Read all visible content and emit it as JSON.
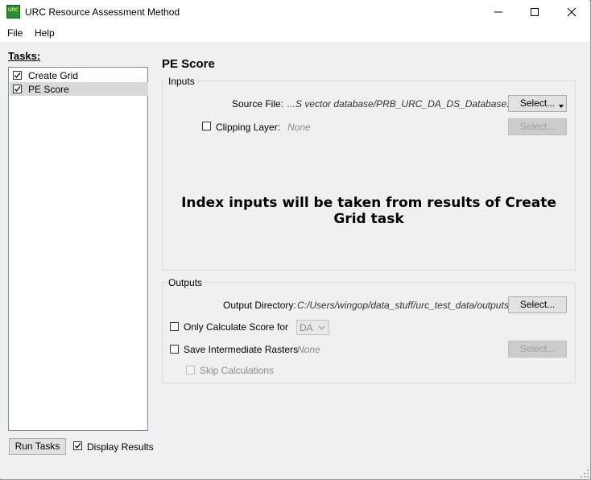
{
  "window": {
    "title": "URC Resource Assessment Method",
    "icon_text": "URC",
    "controls": [
      "minimize-icon",
      "maximize-icon",
      "close-icon"
    ]
  },
  "menu": {
    "items": [
      "File",
      "Help"
    ]
  },
  "tasks": {
    "label": "Tasks:",
    "items": [
      {
        "label": "Create Grid",
        "checked": true,
        "selected": false
      },
      {
        "label": "PE Score",
        "checked": true,
        "selected": true
      }
    ],
    "run_button": "Run Tasks",
    "display_results": {
      "label": "Display Results",
      "checked": true
    }
  },
  "pe_score": {
    "title": "PE Score",
    "inputs": {
      "group_title": "Inputs",
      "source_file": {
        "label": "Source File:",
        "value": "...S vector database/PRB_URC_DA_DS_Database.gdb",
        "button": "Select..."
      },
      "clipping_layer": {
        "label": "Clipping Layer:",
        "checked": false,
        "value": "None",
        "button": "Select..."
      },
      "message": "Index inputs will be taken from results of Create Grid task"
    },
    "outputs": {
      "group_title": "Outputs",
      "output_directory": {
        "label": "Output Directory:",
        "value": "C:/Users/wingop/data_stuff/urc_test_data/outputs",
        "button": "Select..."
      },
      "only_calculate": {
        "label": "Only Calculate Score for",
        "checked": false,
        "selected_option": "DA"
      },
      "save_intermediate": {
        "label": "Save Intermediate Rasters",
        "checked": false,
        "value": "None",
        "button": "Select..."
      },
      "skip_calculations": {
        "label": "Skip Calculations",
        "checked": false
      }
    }
  },
  "colors": {
    "background": "#f0f0f0",
    "selection": "#d9d9d9",
    "icon_green": "#2e8b3a",
    "icon_yellow": "#ffe600"
  }
}
